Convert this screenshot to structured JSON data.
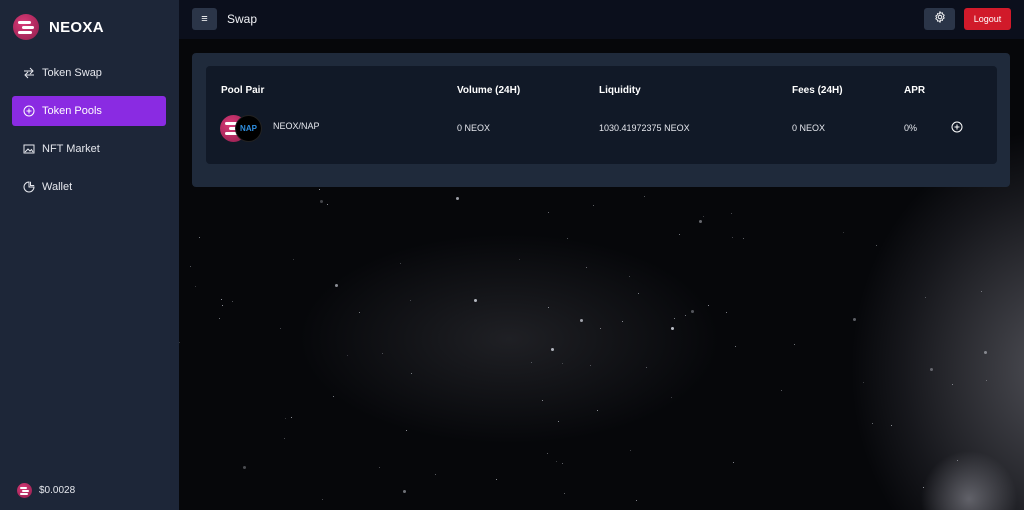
{
  "app": {
    "name": "NEOXA"
  },
  "sidebar": {
    "items": [
      {
        "label": "Token Swap",
        "icon": "swap-arrows-icon"
      },
      {
        "label": "Token Pools",
        "icon": "plus-circle-icon",
        "active": true
      },
      {
        "label": "NFT Market",
        "icon": "image-icon"
      },
      {
        "label": "Wallet",
        "icon": "pie-chart-icon"
      }
    ],
    "price": "$0.0028"
  },
  "header": {
    "menu_icon": "≡",
    "title": "Swap",
    "logout_label": "Logout"
  },
  "pool_table": {
    "columns": [
      "Pool Pair",
      "Volume (24H)",
      "Liquidity",
      "Fees (24H)",
      "APR"
    ],
    "rows": [
      {
        "pair": "NEOX/NAP",
        "token_b_badge": "NAP",
        "volume": "0 NEOX",
        "liquidity": "1030.41972375 NEOX",
        "fees": "0 NEOX",
        "apr": "0%"
      }
    ]
  },
  "colors": {
    "sidebar_bg": "#1d2638",
    "active_accent": "#8a2be2",
    "logout_red": "#d11a2a",
    "card_bg": "#1f2a3b",
    "inner_card_bg": "#111927"
  }
}
